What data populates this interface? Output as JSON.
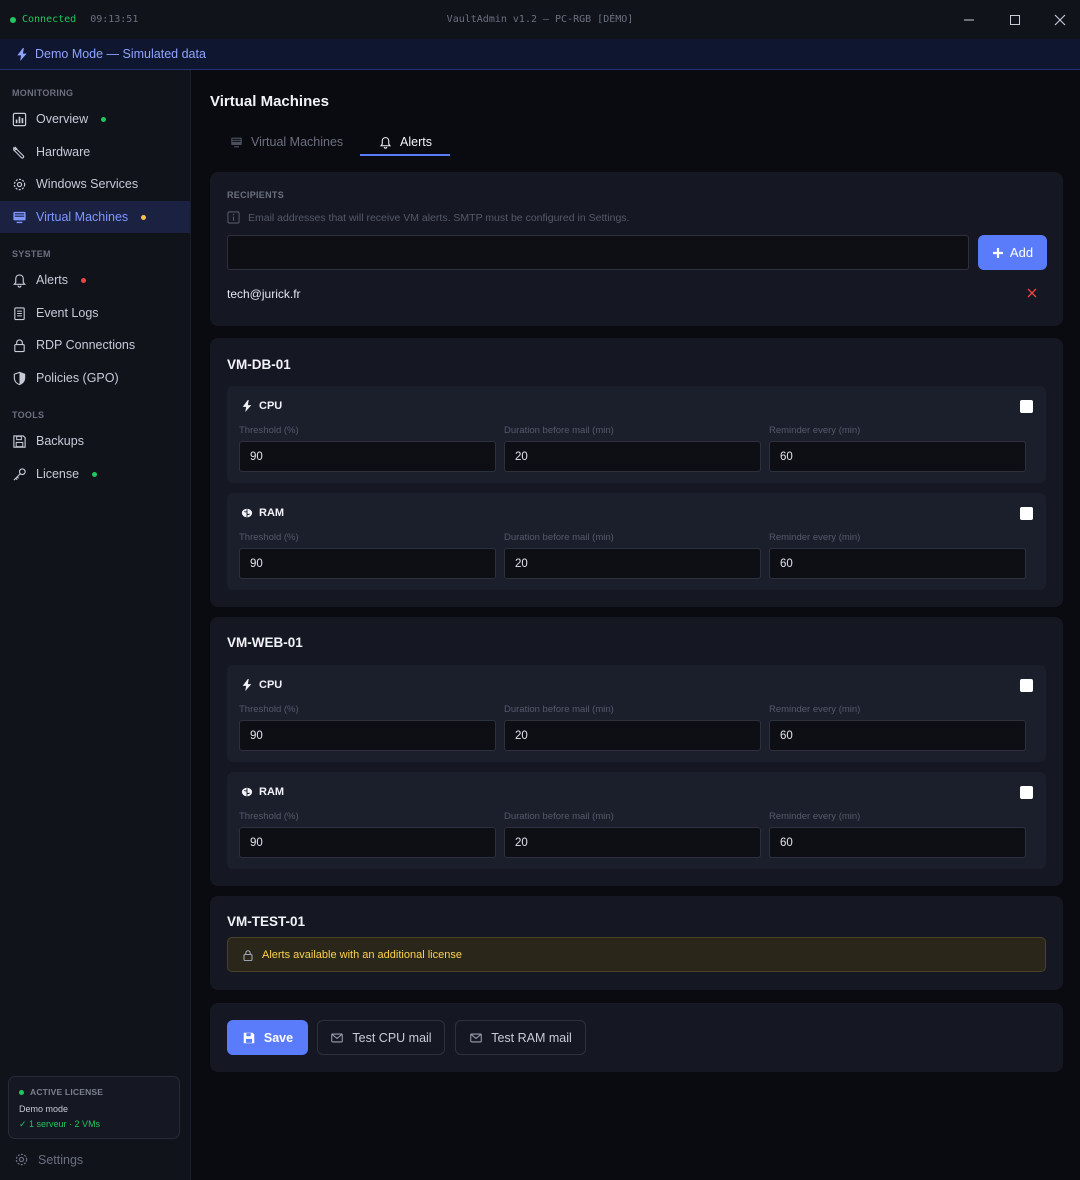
{
  "titlebar": {
    "status": "Connected",
    "time": "09:13:51",
    "title": "VaultAdmin v1.2 — PC-RGB [DÉMO]"
  },
  "banner": {
    "text": "Demo Mode — Simulated data"
  },
  "sidebar": {
    "sections": [
      "MONITORING",
      "SYSTEM",
      "TOOLS"
    ],
    "items": [
      {
        "label": "Overview",
        "icon": "bar-chart-icon",
        "dot": "#22c55e"
      },
      {
        "label": "Hardware",
        "icon": "wrench-icon"
      },
      {
        "label": "Windows Services",
        "icon": "gear-icon"
      },
      {
        "label": "Virtual Machines",
        "icon": "monitor-icon",
        "dot": "#f5c242",
        "active": true
      },
      {
        "label": "Alerts",
        "icon": "bell-icon",
        "dot": "#ef4444"
      },
      {
        "label": "Event Logs",
        "icon": "clipboard-icon"
      },
      {
        "label": "RDP Connections",
        "icon": "lock-icon"
      },
      {
        "label": "Policies (GPO)",
        "icon": "shield-icon"
      },
      {
        "label": "Backups",
        "icon": "floppy-icon"
      },
      {
        "label": "License",
        "icon": "key-icon",
        "dot": "#22c55e"
      }
    ],
    "license": {
      "heading": "ACTIVE LICENSE",
      "mode": "Demo mode",
      "scope": "✓ 1 serveur · 2 VMs"
    },
    "settings_label": "Settings"
  },
  "page": {
    "title": "Virtual Machines",
    "tabs": [
      {
        "label": "Virtual Machines",
        "icon": "monitor-icon"
      },
      {
        "label": "Alerts",
        "icon": "bell-icon",
        "active": true
      }
    ]
  },
  "recipients": {
    "heading": "RECIPIENTS",
    "info": "Email addresses that will receive VM alerts. SMTP must be configured in Settings.",
    "input_value": "",
    "add_label": "Add",
    "emails": [
      "tech@jurick.fr"
    ]
  },
  "field_labels": {
    "threshold": "Threshold (%)",
    "duration": "Duration before mail (min)",
    "reminder": "Reminder every (min)"
  },
  "vms": [
    {
      "name": "VM-DB-01",
      "metrics": [
        {
          "label": "CPU",
          "threshold": "90",
          "duration": "20",
          "reminder": "60",
          "enabled": false
        },
        {
          "label": "RAM",
          "threshold": "90",
          "duration": "20",
          "reminder": "60",
          "enabled": false
        }
      ]
    },
    {
      "name": "VM-WEB-01",
      "metrics": [
        {
          "label": "CPU",
          "threshold": "90",
          "duration": "20",
          "reminder": "60",
          "enabled": false
        },
        {
          "label": "RAM",
          "threshold": "90",
          "duration": "20",
          "reminder": "60",
          "enabled": false
        }
      ]
    },
    {
      "name": "VM-TEST-01",
      "license_notice": "Alerts available with an additional license"
    }
  ],
  "actions": {
    "save": "Save",
    "test_cpu": "Test CPU mail",
    "test_ram": "Test RAM mail"
  },
  "colors": {
    "accent": "#5b7cfa",
    "connected": "#22c55e",
    "warning": "#f5c242",
    "error": "#ef4444"
  }
}
